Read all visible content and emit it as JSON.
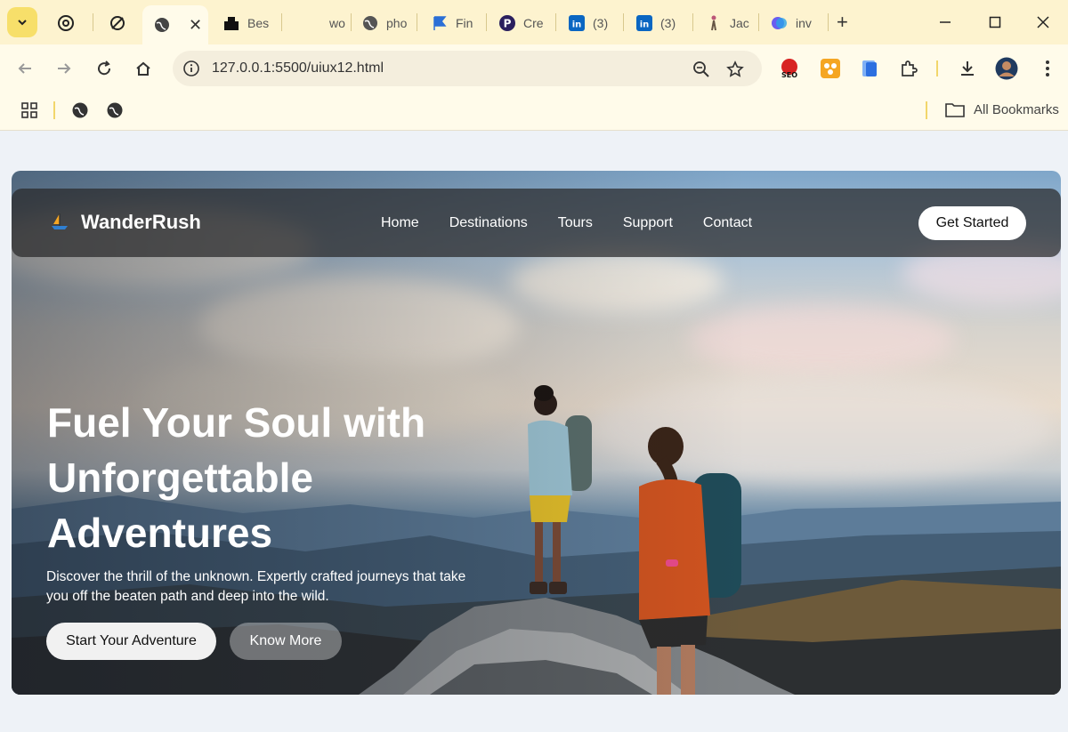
{
  "browser": {
    "tabs": [
      {
        "title": "",
        "icon": "openai-icon"
      },
      {
        "title": "",
        "icon": "slashed-circle-icon"
      },
      {
        "title": "",
        "icon": "globe-icon",
        "active": true
      },
      {
        "title": "Bes",
        "icon": "site-icon"
      },
      {
        "title": "wo",
        "icon": "blank-icon"
      },
      {
        "title": "pho",
        "icon": "globe-icon"
      },
      {
        "title": "Fin",
        "icon": "flag-icon"
      },
      {
        "title": "Cre",
        "icon": "p-logo-icon"
      },
      {
        "title": "(3)",
        "icon": "linkedin-icon"
      },
      {
        "title": "(3)",
        "icon": "linkedin-icon"
      },
      {
        "title": "Jac",
        "icon": "figure-icon"
      },
      {
        "title": "inv",
        "icon": "copilot-icon"
      }
    ],
    "url": "127.0.0.1:5500/uiux12.html",
    "all_bookmarks_label": "All Bookmarks",
    "accent_color": "#fdf3cf"
  },
  "site": {
    "brand": "WanderRush",
    "nav": [
      "Home",
      "Destinations",
      "Tours",
      "Support",
      "Contact"
    ],
    "cta_label": "Get Started",
    "headline": "Fuel Your Soul with Unforgettable Adventures",
    "subtext": "Discover the thrill of the unknown. Expertly crafted journeys that take you off the beaten path and deep into the wild.",
    "primary_button": "Start Your Adventure",
    "secondary_button": "Know More"
  }
}
